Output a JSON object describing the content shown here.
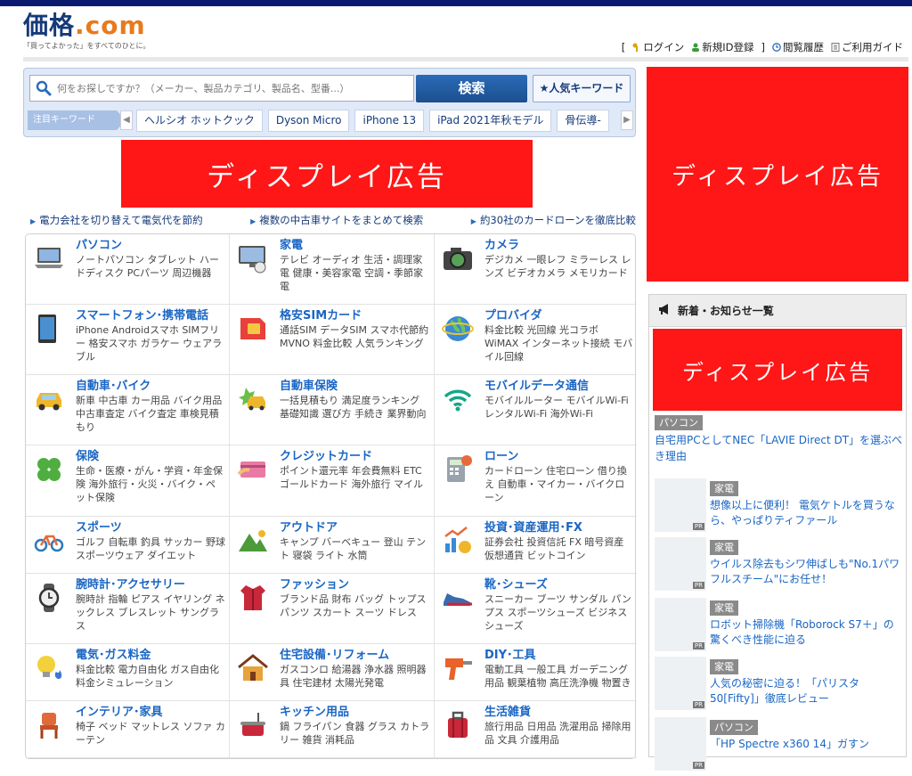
{
  "header": {
    "logo": "価格.com",
    "logo_main": "価格",
    "logo_dot": ".com",
    "tagline": "「買ってよかった」をすべてのひとに。",
    "nav": {
      "bracket_open": "[",
      "login": "ログイン",
      "register": "新規ID登録",
      "bracket_close": "]",
      "history": "閲覧履歴",
      "guide": "ご利用ガイド"
    }
  },
  "search": {
    "placeholder": "何をお探しですか？（メーカー、製品カテゴリ、製品名、型番...）",
    "button": "検索",
    "popular": "★人気キーワード",
    "keyword_label": "注目キーワード",
    "prev": "◀",
    "next": "▶",
    "keywords": [
      "ヘルシオ ホットクック",
      "Dyson Micro",
      "iPhone 13",
      "iPad 2021年秋モデル",
      "骨伝導-"
    ]
  },
  "ads": {
    "main": "ディスプレイ広告",
    "right1": "ディスプレイ広告",
    "right2": "ディスプレイ広告"
  },
  "promos": [
    "電力会社を切り替えて電気代を節約",
    "複数の中古車サイトをまとめて検索",
    "約30社のカードローンを徹底比較"
  ],
  "categories": [
    {
      "title": "パソコン",
      "subs": "ノートパソコン タブレット ハードディスク PCパーツ 周辺機器",
      "icon": "laptop-icon"
    },
    {
      "title": "家電",
      "subs": "テレビ オーディオ 生活・調理家電 健康・美容家電 空調・季節家電",
      "icon": "tv-icon"
    },
    {
      "title": "カメラ",
      "subs": "デジカメ 一眼レフ ミラーレス レンズ ビデオカメラ メモリカード",
      "icon": "camera-icon"
    },
    {
      "title": "スマートフォン･携帯電話",
      "subs": "iPhone Androidスマホ SIMフリー 格安スマホ ガラケー ウェアラブル",
      "icon": "smartphone-icon"
    },
    {
      "title": "格安SIMカード",
      "subs": "通話SIM データSIM スマホ代節約 MVNO 料金比較 人気ランキング",
      "icon": "sim-card-icon"
    },
    {
      "title": "プロバイダ",
      "subs": "料金比較 光回線 光コラボ WiMAX インターネット接続 モバイル回線",
      "icon": "globe-icon"
    },
    {
      "title": "自動車･バイク",
      "subs": "新車 中古車 カー用品 バイク用品 中古車査定 バイク査定 車検見積もり",
      "icon": "car-icon"
    },
    {
      "title": "自動車保険",
      "subs": "一括見積もり 満足度ランキング 基礎知識 選び方 手続き 業界動向",
      "icon": "car-insurance-icon"
    },
    {
      "title": "モバイルデータ通信",
      "subs": "モバイルルーター モバイルWi-Fi レンタルWi-Fi 海外Wi-Fi",
      "icon": "wifi-icon"
    },
    {
      "title": "保険",
      "subs": "生命・医療・がん・学資・年金保険 海外旅行・火災・バイク・ペット保険",
      "icon": "clover-icon"
    },
    {
      "title": "クレジットカード",
      "subs": "ポイント還元率 年会費無料 ETC ゴールドカード 海外旅行 マイル",
      "icon": "credit-card-icon"
    },
    {
      "title": "ローン",
      "subs": "カードローン 住宅ローン 借り換え 自動車・マイカー・バイクローン",
      "icon": "calculator-icon"
    },
    {
      "title": "スポーツ",
      "subs": "ゴルフ 自転車 釣具 サッカー 野球 スポーツウェア ダイエット",
      "icon": "bicycle-icon"
    },
    {
      "title": "アウトドア",
      "subs": "キャンプ バーベキュー 登山 テント 寝袋 ライト 水筒",
      "icon": "mountain-icon"
    },
    {
      "title": "投資･資産運用･FX",
      "subs": "証券会社 投資信託 FX 暗号資産 仮想通貨 ビットコイン",
      "icon": "chart-icon"
    },
    {
      "title": "腕時計･アクセサリー",
      "subs": "腕時計 指輪 ピアス イヤリング ネックレス ブレスレット サングラス",
      "icon": "watch-icon"
    },
    {
      "title": "ファッション",
      "subs": "ブランド品 財布 バッグ トップス パンツ スカート スーツ ドレス",
      "icon": "jacket-icon"
    },
    {
      "title": "靴･シューズ",
      "subs": "スニーカー ブーツ サンダル パンプス スポーツシューズ ビジネスシューズ",
      "icon": "shoe-icon"
    },
    {
      "title": "電気･ガス料金",
      "subs": "料金比較 電力自由化 ガス自由化 料金シミュレーション",
      "icon": "lightbulb-icon"
    },
    {
      "title": "住宅設備･リフォーム",
      "subs": "ガスコンロ 給湯器 浄水器 照明器具 住宅建材 太陽光発電",
      "icon": "house-icon"
    },
    {
      "title": "DIY･工具",
      "subs": "電動工具 一般工具 ガーデニング用品 観葉植物 高圧洗浄機 物置き",
      "icon": "drill-icon"
    },
    {
      "title": "インテリア･家具",
      "subs": "椅子 ベッド マットレス ソファ カーテン",
      "icon": "chair-icon"
    },
    {
      "title": "キッチン用品",
      "subs": "鍋 フライパン 食器 グラス カトラリー 雑貨 消耗品",
      "icon": "pot-icon"
    },
    {
      "title": "生活雑貨",
      "subs": "旅行用品 日用品 洗濯用品 掃除用品 文具 介護用品",
      "icon": "suitcase-icon"
    }
  ],
  "news": {
    "heading": "新着・お知らせ一覧",
    "feature_tag": "パソコン",
    "feature_text": "自宅用PCとしてNEC「LAVIE Direct DT」を選ぶべき理由",
    "pr": "PR",
    "items": [
      {
        "tag": "家電",
        "text": "想像以上に便利！ 電気ケトルを買うなら、やっぱりティファール"
      },
      {
        "tag": "家電",
        "text": "ウイルス除去もシワ伸ばしも\"No.1パワフルスチーム\"にお任せ！"
      },
      {
        "tag": "家電",
        "text": "ロボット掃除機「Roborock S7＋」の驚くべき性能に迫る"
      },
      {
        "tag": "家電",
        "text": "人気の秘密に迫る！「パリスタ 50[Fifty]」徹底レビュー"
      },
      {
        "tag": "パソコン",
        "text": "「HP Spectre x360 14」ガすン"
      }
    ]
  },
  "colors": {
    "topbar": "#0a1a6e",
    "link": "#1a66c4",
    "ad": "#ff1616",
    "search_button": "#1c4f8e"
  }
}
